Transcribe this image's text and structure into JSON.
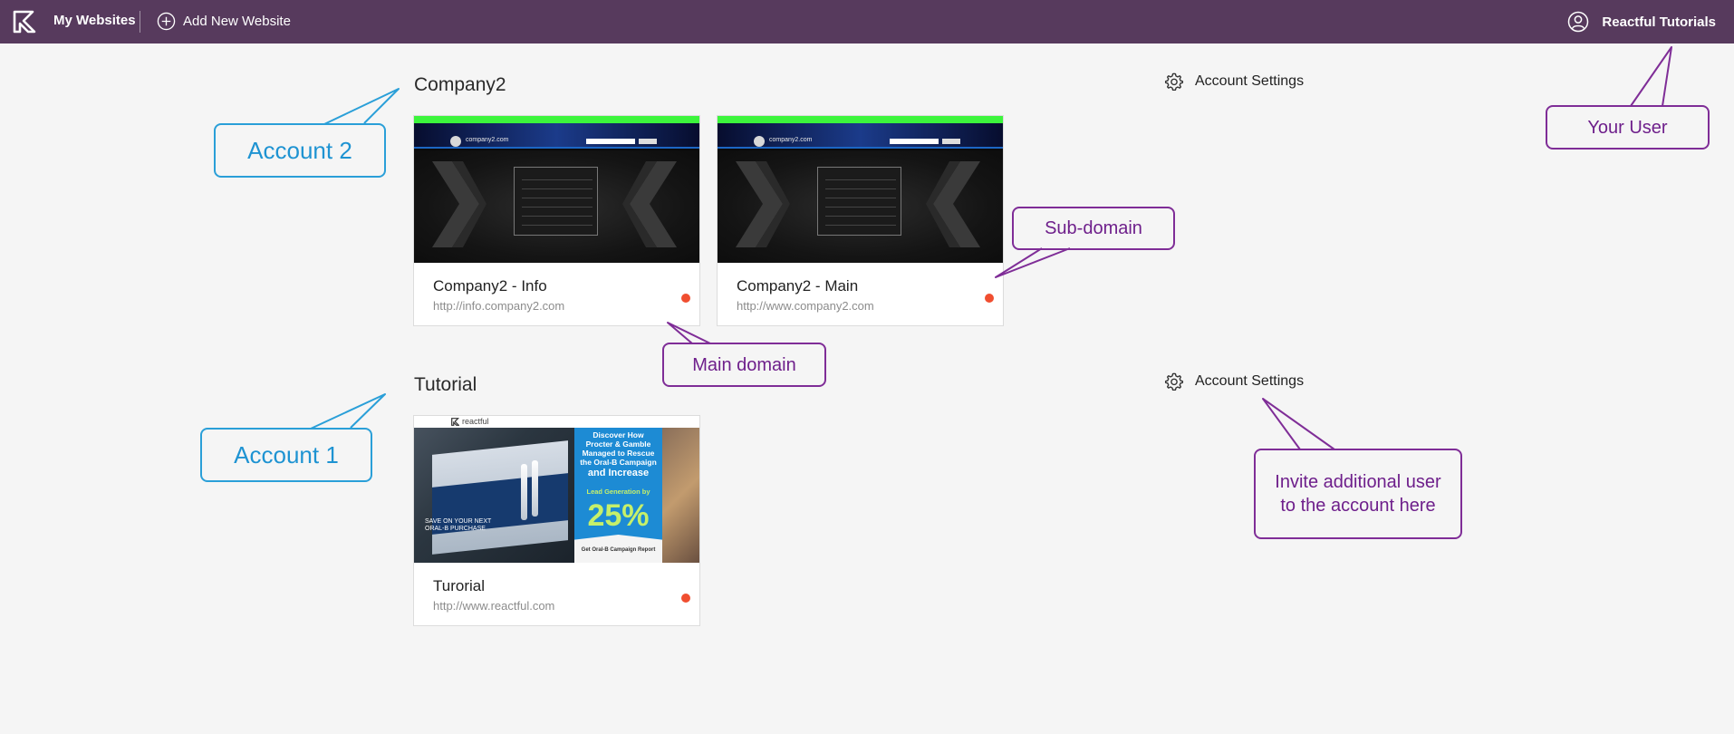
{
  "topbar": {
    "logo": "reactful-logo",
    "my_websites": "My Websites",
    "add_new_website": "Add New Website",
    "user_name": "Reactful Tutorials"
  },
  "accounts": [
    {
      "title": "Company2",
      "settings_label": "Account Settings",
      "sites": [
        {
          "name": "Company2 - Info",
          "url": "http://info.company2.com",
          "thumbnail": "parked-domain",
          "thumb_domain": "company2.com",
          "status": "red"
        },
        {
          "name": "Company2 - Main",
          "url": "http://www.company2.com",
          "thumbnail": "parked-domain",
          "thumb_domain": "company2.com",
          "status": "red"
        }
      ]
    },
    {
      "title": "Tutorial",
      "settings_label": "Account Settings",
      "sites": [
        {
          "name": "Turorial",
          "url": "http://www.reactful.com",
          "thumbnail": "ad-banner",
          "status": "red"
        }
      ]
    }
  ],
  "ad_thumbnail": {
    "brand": "reactful",
    "headline": [
      "Discover How",
      "Procter & Gamble",
      "Managed to Rescue",
      "the Oral-B Campaign"
    ],
    "headline_big": "and Increase",
    "lead": "Lead Generation by",
    "percent": "25%",
    "footer": "Get Oral-B Campaign Report",
    "save_text": [
      "SAVE ON YOUR NEXT",
      "ORAL-B PURCHASE"
    ]
  },
  "callouts": {
    "account2": "Account 2",
    "account1": "Account 1",
    "subdomain": "Sub-domain",
    "main_domain": "Main domain",
    "your_user": "Your User",
    "invite_line1": "Invite additional user",
    "invite_line2": "to the account here"
  },
  "colors": {
    "topbar": "#573a5d",
    "background": "#f5f5f5",
    "status_dot": "#f04e30",
    "callout_blue": "#2a9fd8",
    "callout_purple": "#7f2d97"
  },
  "icons": [
    "reactful-logo",
    "plus-circle-icon",
    "user-circle-icon",
    "gear-icon"
  ]
}
